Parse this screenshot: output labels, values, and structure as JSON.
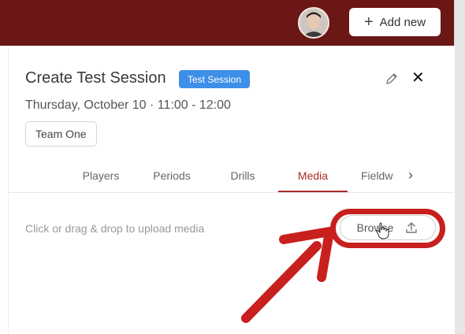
{
  "header": {
    "avatar_icon": "user-avatar",
    "add_new_icon": "plus-icon",
    "add_new_label": "Add new",
    "plus_symbol": "+"
  },
  "session": {
    "title": "Create Test Session",
    "badge": "Test Session",
    "datetime": "Thursday, October 10 · 11:00 - 12:00",
    "team": "Team One",
    "edit_icon": "pencil-icon",
    "close_icon": "close-icon",
    "close_symbol": "✕"
  },
  "tabs": [
    {
      "label": "Players",
      "active": false
    },
    {
      "label": "Periods",
      "active": false
    },
    {
      "label": "Drills",
      "active": false
    },
    {
      "label": "Media",
      "active": true
    },
    {
      "label": "Fieldw",
      "active": false
    }
  ],
  "tabs_next_symbol": "›",
  "media": {
    "hint": "Click or drag & drop to upload media",
    "browse_label": "Browse",
    "browse_icon": "upload-icon"
  },
  "annotation": {
    "color": "#c8201e",
    "arrow_icon": "red-arrow-pointer",
    "cursor_icon": "hand-cursor-icon"
  },
  "colors": {
    "header_bg": "#6b1716",
    "badge_bg": "#3d8fe8",
    "active_tab": "#a92a2a"
  }
}
